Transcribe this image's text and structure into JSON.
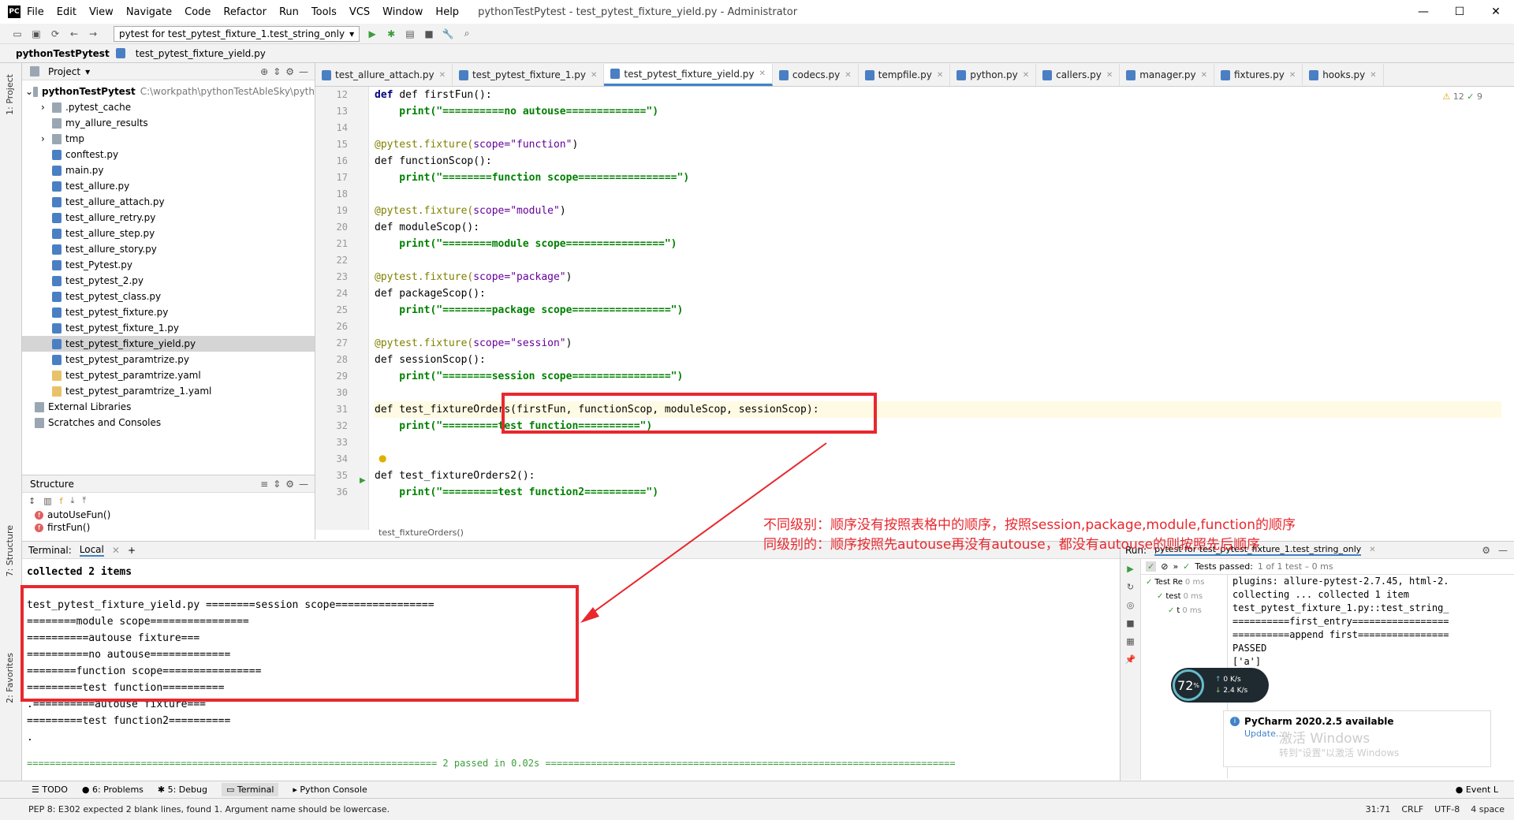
{
  "window": {
    "title": "pythonTestPytest - test_pytest_fixture_yield.py - Administrator",
    "logo": "PC",
    "menu": [
      "File",
      "Edit",
      "View",
      "Navigate",
      "Code",
      "Refactor",
      "Run",
      "Tools",
      "VCS",
      "Window",
      "Help"
    ]
  },
  "toolbar": {
    "run_config": "pytest for test_pytest_fixture_1.test_string_only"
  },
  "nav": {
    "project": "pythonTestPytest",
    "file": "test_pytest_fixture_yield.py"
  },
  "sidebar_tabs": {
    "project": "1: Project",
    "structure": "7: Structure",
    "favorites": "2: Favorites"
  },
  "project": {
    "header": "Project",
    "root": "pythonTestPytest",
    "root_path": "C:\\workpath\\pythonTestAbleSky\\pyth",
    "items": [
      ".pytest_cache",
      "my_allure_results",
      "tmp",
      "conftest.py",
      "main.py",
      "test_allure.py",
      "test_allure_attach.py",
      "test_allure_retry.py",
      "test_allure_step.py",
      "test_allure_story.py",
      "test_Pytest.py",
      "test_pytest_2.py",
      "test_pytest_class.py",
      "test_pytest_fixture.py",
      "test_pytest_fixture_1.py",
      "test_pytest_fixture_yield.py",
      "test_pytest_paramtrize.py",
      "test_pytest_paramtrize.yaml",
      "test_pytest_paramtrize_1.yaml"
    ],
    "external": "External Libraries",
    "scratches": "Scratches and Consoles"
  },
  "structure": {
    "header": "Structure",
    "items": [
      "autoUseFun()",
      "firstFun()"
    ]
  },
  "tabs": [
    "test_allure_attach.py",
    "test_pytest_fixture_1.py",
    "test_pytest_fixture_yield.py",
    "codecs.py",
    "tempfile.py",
    "python.py",
    "callers.py",
    "manager.py",
    "fixtures.py",
    "hooks.py"
  ],
  "inspections": {
    "warnings": "12",
    "weak": "9"
  },
  "lines": [
    "12",
    "13",
    "14",
    "15",
    "16",
    "17",
    "18",
    "19",
    "20",
    "21",
    "22",
    "23",
    "24",
    "25",
    "26",
    "27",
    "28",
    "29",
    "30",
    "31",
    "32",
    "33",
    "34",
    "35",
    "36"
  ],
  "code": {
    "l12": "def firstFun():",
    "l13": "    print(\"==========no autouse=============\")",
    "l15a": "@pytest.fixture(",
    "l15b": "scope=\"function\"",
    "l15c": ")",
    "l16": "def functionScop():",
    "l17": "    print(\"========function scope================\")",
    "l19a": "@pytest.fixture(",
    "l19b": "scope=\"module\"",
    "l19c": ")",
    "l20": "def moduleScop():",
    "l21": "    print(\"========module scope================\")",
    "l23a": "@pytest.fixture(",
    "l23b": "scope=\"package\"",
    "l23c": ")",
    "l24": "def packageScop():",
    "l25": "    print(\"========package scope================\")",
    "l27a": "@pytest.fixture(",
    "l27b": "scope=\"session\"",
    "l27c": ")",
    "l28": "def sessionScop():",
    "l29": "    print(\"========session scope================\")",
    "l31": "def test_fixtureOrders(firstFun, functionScop, moduleScop, sessionScop):",
    "l32": "    print(\"=========test function==========\")",
    "l35": "def test_fixtureOrders2():",
    "l36": "    print(\"=========test function2==========\")"
  },
  "breadcrumb": "test_fixtureOrders()",
  "annotation": {
    "line1": "不同级别：顺序没有按照表格中的顺序，按照session,package,module,function的顺序",
    "line2": "同级别的：顺序按照先autouse再没有autouse，都没有autouse的则按照先后顺序"
  },
  "terminal": {
    "label": "Terminal:",
    "tab": "Local",
    "lines": [
      "collected 2 items",
      "",
      "test_pytest_fixture_yield.py ========session scope================",
      "========module scope================",
      "==========autouse fixture===",
      "==========no autouse=============",
      "========function scope================",
      "=========test function==========",
      ".==========autouse fixture===",
      "=========test function2==========",
      "."
    ],
    "summary_line": "======================================================================== 2 passed in 0.02s ========================================================================"
  },
  "run": {
    "label": "Run:",
    "config": "pytest for test_pytest_fixture_1.test_string_only",
    "passed": "Tests passed:",
    "passed_count": "1 of 1 test – 0 ms",
    "tree": [
      {
        "n": "Test Re",
        "t": "0 ms"
      },
      {
        "n": "test",
        "t": "0 ms"
      },
      {
        "n": "t",
        "t": "0 ms"
      }
    ],
    "output": [
      "plugins: allure-pytest-2.7.45, html-2.",
      "collecting ... collected 1 item",
      "",
      "test_pytest_fixture_1.py::test_string_",
      "==========first_entry=================",
      "==========append first================",
      "PASSED",
      "['a']",
      "['a']"
    ],
    "notice_title": "PyCharm 2020.2.5 available",
    "notice_link": "Update...",
    "watermark1": "激活 Windows",
    "watermark2": "转到\"设置\"以激活 Windows"
  },
  "speed": {
    "percent": "72",
    "unit": "%",
    "up": "0 K/s",
    "down": "2.4 K/s"
  },
  "bottom": {
    "todo": "TODO",
    "problems": "6: Problems",
    "debug": "5: Debug",
    "terminal": "Terminal",
    "console": "Python Console",
    "event": "Event L"
  },
  "status": {
    "msg": "PEP 8: E302 expected 2 blank lines, found 1. Argument name should be lowercase.",
    "pos": "31:71",
    "crlf": "CRLF",
    "enc": "UTF-8",
    "indent": "4 space"
  },
  "colors": {
    "accent": "#4083c9",
    "annotation": "#e8282e"
  }
}
